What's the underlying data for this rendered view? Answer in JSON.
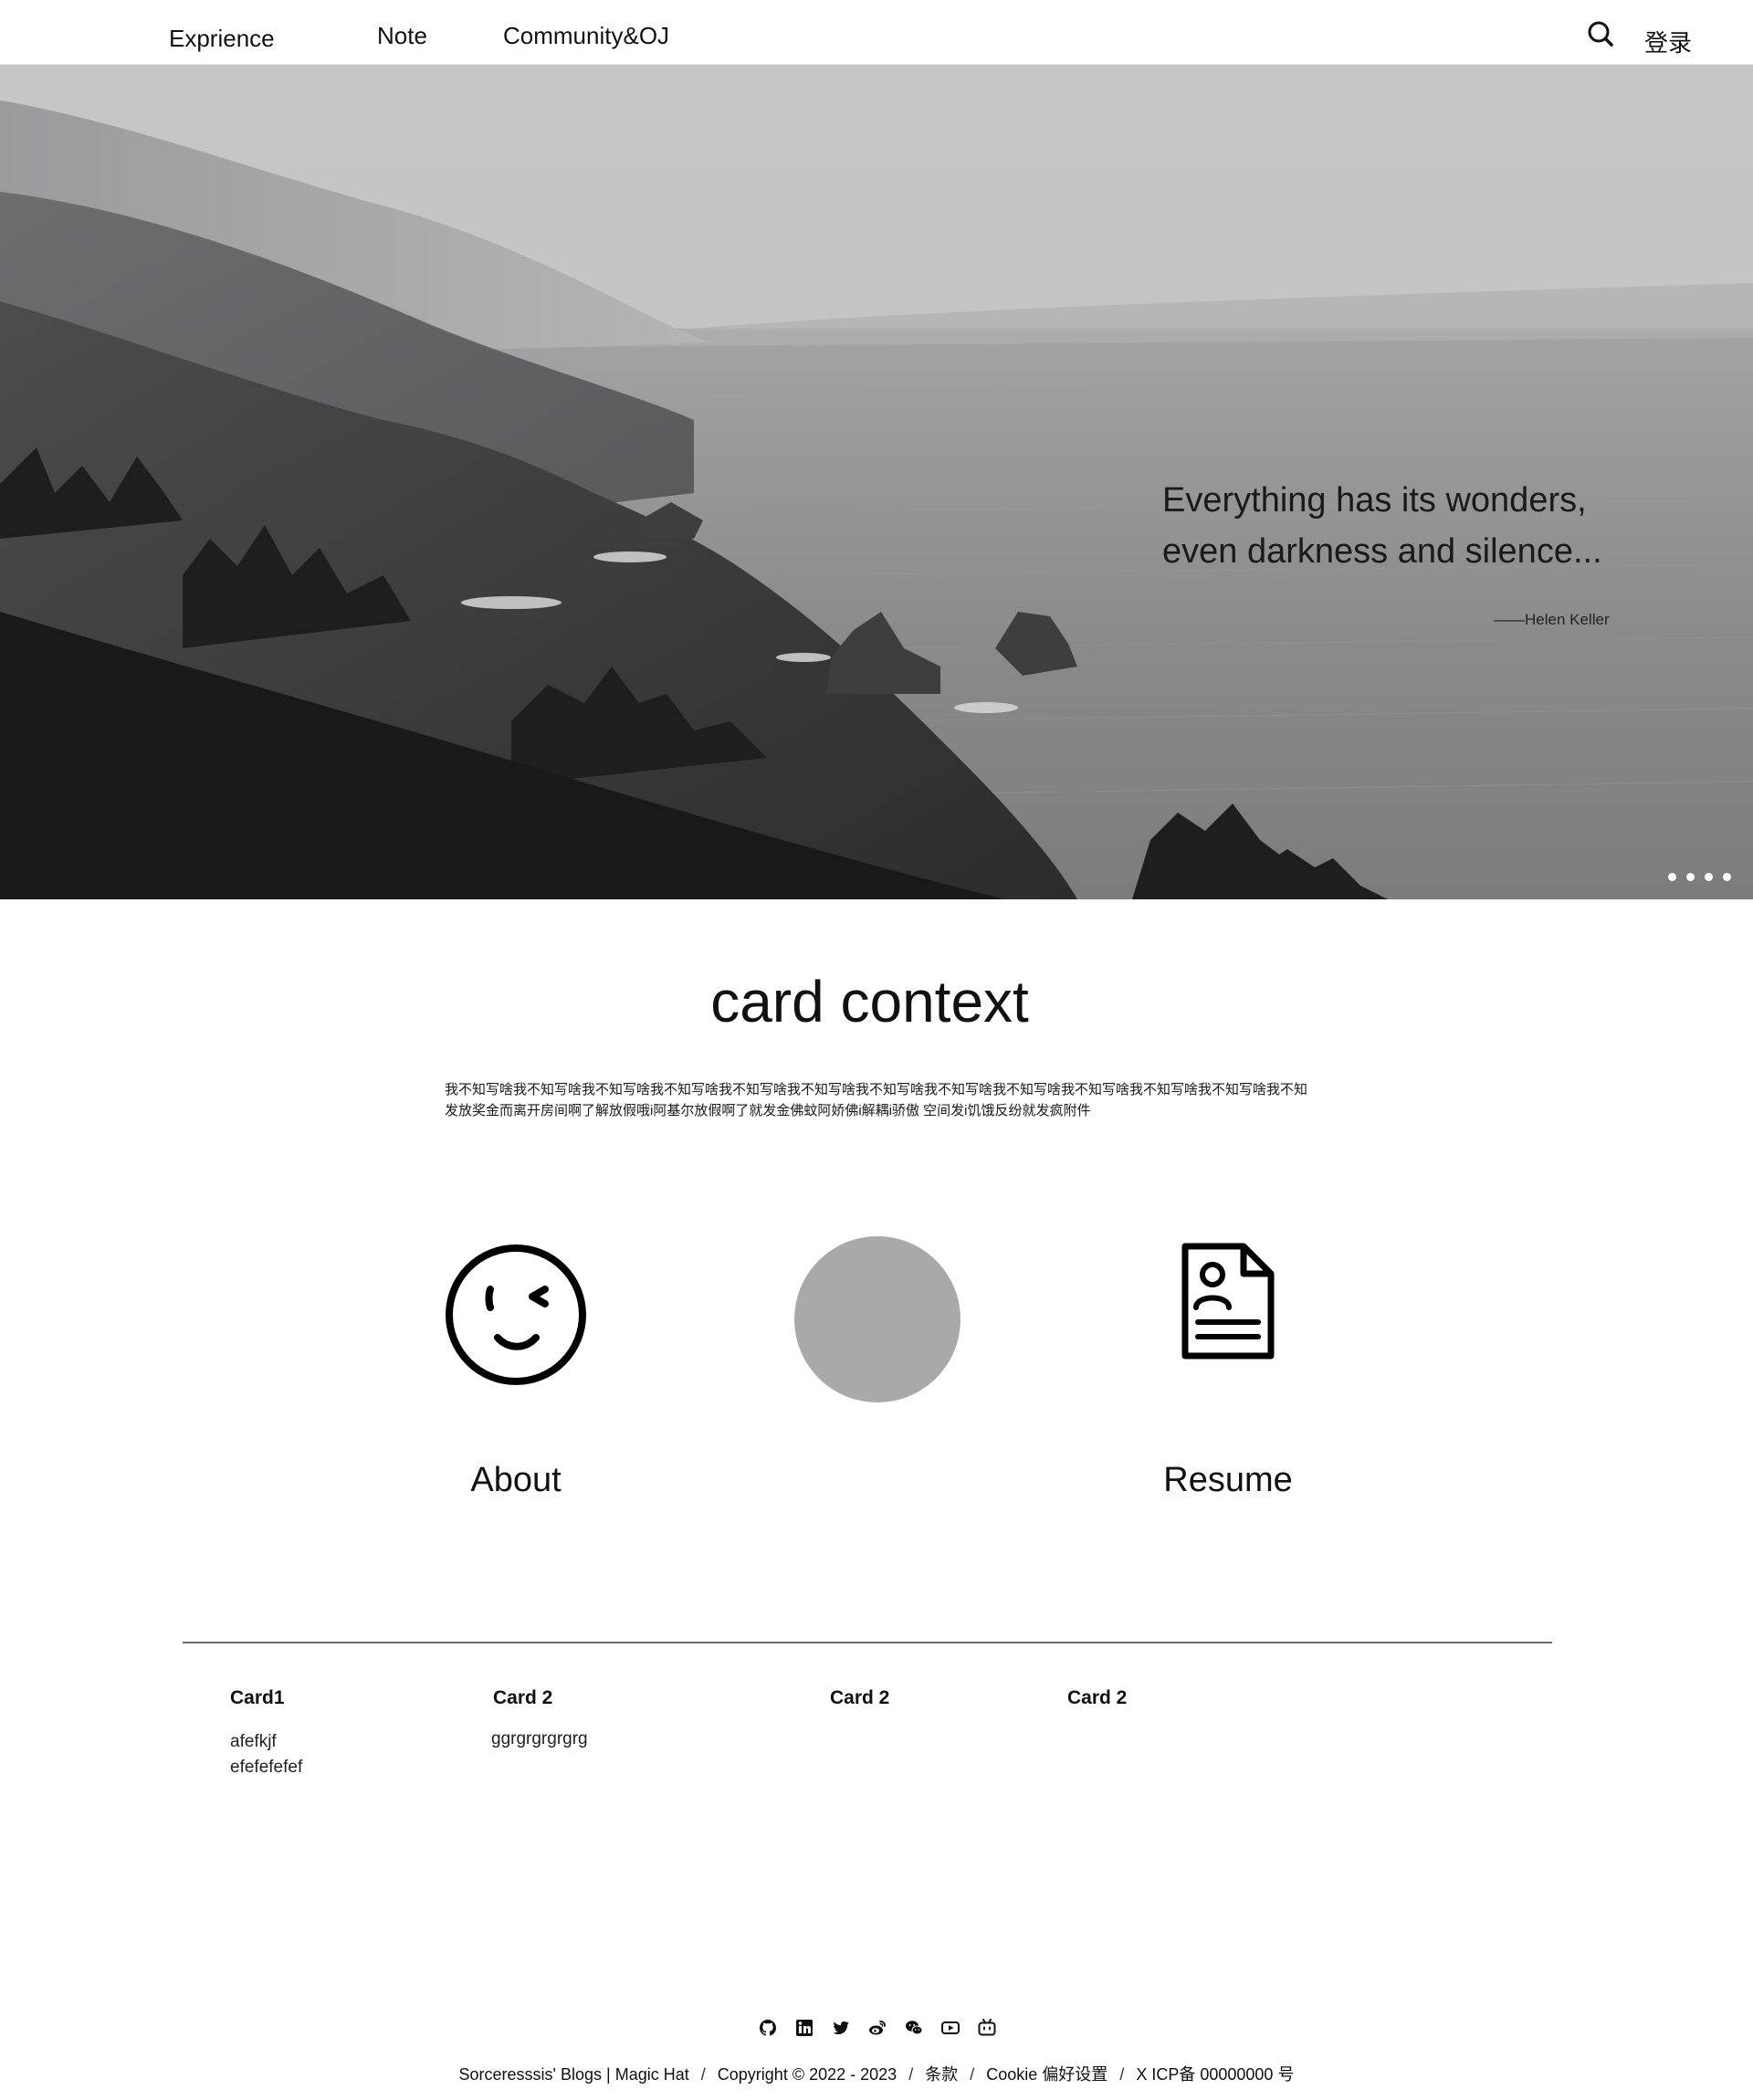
{
  "nav": {
    "links": [
      "Exprience",
      "Note",
      "Community&OJ"
    ],
    "search_icon": "search-icon",
    "login_label": "登录"
  },
  "hero": {
    "quote_lines": [
      "Everything has its wonders,",
      "even darkness and silence..."
    ],
    "author": "——Helen Keller",
    "slide_count": 4,
    "image": "grayscale coastal cliffs and ocean"
  },
  "section": {
    "title": "card context",
    "description_lines": [
      "我不知写啥我不知写啥我不知写啥我不知写啥我不知写啥我不知写啥我不知写啥我不知写啥我不知写啥我不知写啥我不知写啥我不知写啥我不知",
      "发放奖金而离开房间啊了解放假哦i阿基尔放假啊了就发金佛蚊阿娇佛i解耦i骄傲 空间发i饥饿反纷就发疯附件"
    ],
    "features": [
      {
        "label": "About",
        "icon": "wink-face-icon"
      },
      {
        "label": "",
        "icon": "avatar-placeholder"
      },
      {
        "label": "Resume",
        "icon": "resume-document-icon"
      }
    ]
  },
  "footer": {
    "cards": [
      {
        "title": "Card1",
        "lines": [
          "afefkjf",
          "efefefefef"
        ]
      },
      {
        "title": "Card 2",
        "lines": [
          "ggrgrgrgrgrg"
        ]
      },
      {
        "title": "Card 2",
        "lines": []
      },
      {
        "title": "Card 2",
        "lines": []
      }
    ],
    "social_icons": [
      "github-icon",
      "linkedin-icon",
      "twitter-icon",
      "weibo-icon",
      "wechat-icon",
      "youtube-icon",
      "bilibili-icon"
    ],
    "copyright": {
      "site": "Sorceresssis' Blogs | Magic Hat",
      "sep": "/",
      "year": "Copyright © 2022 - 2023",
      "terms": "条款",
      "cookie": "Cookie 偏好设置",
      "icp": "X ICP备 00000000 号"
    }
  },
  "colors": {
    "background": "#ffffff",
    "text": "#111111",
    "avatar_placeholder": "#a9a9aa",
    "divider": "#6a6a6a"
  }
}
